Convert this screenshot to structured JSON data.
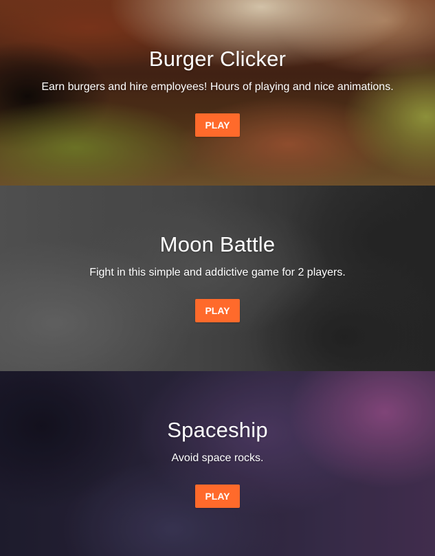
{
  "accent_color": "#ff6a2b",
  "games": [
    {
      "title": "Burger Clicker",
      "description": "Earn burgers and hire employees! Hours of playing and nice animations.",
      "play_label": "PLAY"
    },
    {
      "title": "Moon Battle",
      "description": "Fight in this simple and addictive game for 2 players.",
      "play_label": "PLAY"
    },
    {
      "title": "Spaceship",
      "description": "Avoid space rocks.",
      "play_label": "PLAY"
    }
  ]
}
